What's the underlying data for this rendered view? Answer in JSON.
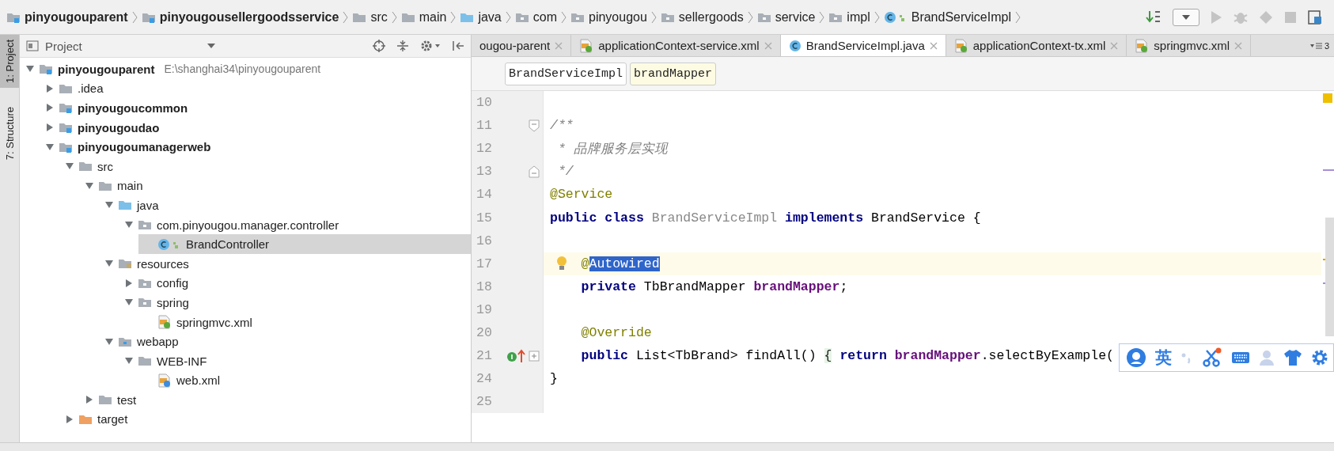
{
  "navbar": [
    {
      "label": "pinyougouparent",
      "kind": "module"
    },
    {
      "label": "pinyougousellergoodsservice",
      "kind": "module"
    },
    {
      "label": "src",
      "kind": "folder"
    },
    {
      "label": "main",
      "kind": "folder"
    },
    {
      "label": "java",
      "kind": "source"
    },
    {
      "label": "com",
      "kind": "package"
    },
    {
      "label": "pinyougou",
      "kind": "package"
    },
    {
      "label": "sellergoods",
      "kind": "package"
    },
    {
      "label": "service",
      "kind": "package"
    },
    {
      "label": "impl",
      "kind": "package"
    },
    {
      "label": "BrandServiceImpl",
      "kind": "class"
    }
  ],
  "tool_strip": [
    {
      "label": "1: Project",
      "selected": true
    },
    {
      "label": "7: Structure",
      "selected": false
    }
  ],
  "project_panel": {
    "title": "Project",
    "tree": [
      {
        "label": "pinyougouparent",
        "kind": "module",
        "path": "E:\\shanghai34\\pinyougouparent",
        "expanded": true,
        "selected": false,
        "children": [
          {
            "label": ".idea",
            "kind": "folder",
            "expanded": false,
            "selected": false
          },
          {
            "label": "pinyougoucommon",
            "kind": "module",
            "expanded": false,
            "selected": false
          },
          {
            "label": "pinyougoudao",
            "kind": "module",
            "expanded": false,
            "selected": false
          },
          {
            "label": "pinyougoumanagerweb",
            "kind": "module",
            "expanded": true,
            "selected": false,
            "children": [
              {
                "label": "src",
                "kind": "folder",
                "expanded": true,
                "selected": false,
                "children": [
                  {
                    "label": "main",
                    "kind": "folder",
                    "expanded": true,
                    "selected": false,
                    "children": [
                      {
                        "label": "java",
                        "kind": "source",
                        "expanded": true,
                        "selected": false,
                        "children": [
                          {
                            "label": "com.pinyougou.manager.controller",
                            "kind": "package",
                            "expanded": true,
                            "selected": false,
                            "children": [
                              {
                                "label": "BrandController",
                                "kind": "class",
                                "selected": true
                              }
                            ]
                          }
                        ]
                      },
                      {
                        "label": "resources",
                        "kind": "resources",
                        "expanded": true,
                        "selected": false,
                        "children": [
                          {
                            "label": "config",
                            "kind": "package",
                            "expanded": false,
                            "selected": false
                          },
                          {
                            "label": "spring",
                            "kind": "package",
                            "expanded": true,
                            "selected": false,
                            "children": [
                              {
                                "label": "springmvc.xml",
                                "kind": "xml",
                                "selected": false
                              }
                            ]
                          }
                        ]
                      },
                      {
                        "label": "webapp",
                        "kind": "webapp",
                        "expanded": true,
                        "selected": false,
                        "children": [
                          {
                            "label": "WEB-INF",
                            "kind": "folder",
                            "expanded": true,
                            "selected": false,
                            "children": [
                              {
                                "label": "web.xml",
                                "kind": "webxml",
                                "selected": false
                              }
                            ]
                          }
                        ]
                      }
                    ]
                  },
                  {
                    "label": "test",
                    "kind": "folder",
                    "expanded": false,
                    "selected": false
                  }
                ]
              },
              {
                "label": "target",
                "kind": "excluded",
                "expanded": false,
                "selected": false
              }
            ]
          }
        ]
      }
    ]
  },
  "tabs": [
    {
      "label": "ougou-parent",
      "kind": "none",
      "selected": false
    },
    {
      "label": "applicationContext-service.xml",
      "kind": "xml",
      "selected": false
    },
    {
      "label": "BrandServiceImpl.java",
      "kind": "class",
      "selected": true
    },
    {
      "label": "applicationContext-tx.xml",
      "kind": "xml",
      "selected": false
    },
    {
      "label": "springmvc.xml",
      "kind": "xml",
      "selected": false
    }
  ],
  "tab_overflow": "3",
  "editor_breadcrumb": [
    {
      "label": "BrandServiceImpl",
      "selected": false
    },
    {
      "label": "brandMapper",
      "selected": true
    }
  ],
  "code": [
    {
      "number": "10"
    },
    {
      "number": "11",
      "gutter_icons": [
        {
          "kind": "fold-open"
        }
      ],
      "tokens": [
        {
          "text": "/**",
          "kind": "comment"
        }
      ]
    },
    {
      "number": "12",
      "tokens": [
        {
          "text": " * 品牌服务层实现",
          "kind": "comment"
        }
      ]
    },
    {
      "number": "13",
      "gutter_icons": [
        {
          "kind": "fold-close"
        }
      ],
      "tokens": [
        {
          "text": " */",
          "kind": "comment"
        }
      ]
    },
    {
      "number": "14",
      "tokens": [
        {
          "text": "@Service",
          "kind": "annotation"
        }
      ]
    },
    {
      "number": "15",
      "tokens": [
        {
          "text": "public class",
          "kind": "keyword"
        },
        {
          "text": " BrandServiceImpl ",
          "kind": "declared"
        },
        {
          "text": "implements",
          "kind": "keyword"
        },
        {
          "text": " BrandService {",
          "kind": "plain"
        }
      ]
    },
    {
      "number": "16"
    },
    {
      "number": "17",
      "current": true,
      "gutter_icons": [
        {
          "kind": "bulb"
        }
      ],
      "tokens": [
        {
          "text": "    @",
          "kind": "annotation"
        },
        {
          "text": "Autowired",
          "kind": "selection"
        }
      ]
    },
    {
      "number": "18",
      "tokens": [
        {
          "text": "    private",
          "kind": "keyword"
        },
        {
          "text": " TbBrandMapper ",
          "kind": "plain"
        },
        {
          "text": "brandMapper",
          "kind": "field"
        },
        {
          "text": ";",
          "kind": "plain"
        }
      ]
    },
    {
      "number": "19"
    },
    {
      "number": "20",
      "tokens": [
        {
          "text": "    @Override",
          "kind": "annotation"
        }
      ]
    },
    {
      "number": "21",
      "gutter_icons": [
        {
          "kind": "override"
        },
        {
          "kind": "fold-plus"
        }
      ],
      "tokens": [
        {
          "text": "    public",
          "kind": "keyword"
        },
        {
          "text": " List<TbBrand> findAll() ",
          "kind": "plain"
        },
        {
          "text": "{",
          "kind": "folded"
        },
        {
          "text": " return",
          "kind": "keyword"
        },
        {
          "text": " brandMapper",
          "kind": "field"
        },
        {
          "text": ".selectByExample(",
          "kind": "plain"
        }
      ]
    },
    {
      "number": "24",
      "tokens": [
        {
          "text": "}",
          "kind": "plain"
        }
      ]
    },
    {
      "number": "25"
    }
  ],
  "ime_toolbar": {
    "mode": "英"
  }
}
